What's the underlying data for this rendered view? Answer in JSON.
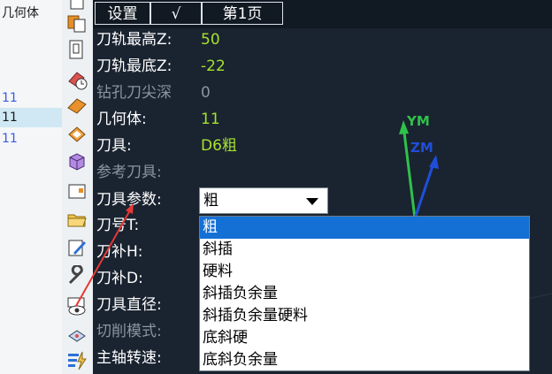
{
  "tree": {
    "items": [
      {
        "label": "几何体",
        "style": "normal"
      },
      {
        "label": "11",
        "style": "blue"
      },
      {
        "label": "11",
        "style": "selected"
      },
      {
        "label": "11",
        "style": "blue"
      }
    ]
  },
  "toolbar": {
    "icons": [
      "document-icon",
      "copy-icon",
      "document-icon",
      "clock-icon",
      "layer-icon",
      "layer-icon",
      "box-icon",
      "folder-icon",
      "folder-open-icon",
      "edit-icon",
      "wrench-icon",
      "view-icon",
      "gear-icon",
      "lightning-icon"
    ]
  },
  "tabs": {
    "settings": "设置",
    "check": "√",
    "page": "第1页"
  },
  "params": {
    "max_z": {
      "label": "刀轨最高Z:",
      "value": "50"
    },
    "min_z": {
      "label": "刀轨最底Z:",
      "value": "-22"
    },
    "drill_depth": {
      "label": "钻孔刀尖深",
      "value": "0"
    },
    "geometry": {
      "label": "几何体:",
      "value": "11"
    },
    "tool": {
      "label": "刀具:",
      "value": "D6粗"
    },
    "ref_tool": {
      "label": "参考刀具:"
    },
    "tool_param": {
      "label": "刀具参数:",
      "value": "粗"
    },
    "tool_no": {
      "label": "刀号T:"
    },
    "comp_h": {
      "label": "刀补H:"
    },
    "comp_d": {
      "label": "刀补D:"
    },
    "diameter": {
      "label": "刀具直径:"
    },
    "cut_mode": {
      "label": "切削模式:"
    },
    "spindle": {
      "label": "主轴转速:"
    }
  },
  "dropdown": {
    "options": [
      "粗",
      "斜插",
      "硬料",
      "斜插负余量",
      "斜插负余量硬料",
      "底斜硬",
      "底斜负余量"
    ],
    "selected_index": 0
  },
  "viewport": {
    "ym_label": "YM",
    "zm_label": "ZM",
    "colors": {
      "ym": "#2fc24a",
      "zm": "#1f4fd8",
      "pointer": "#e53935"
    }
  }
}
